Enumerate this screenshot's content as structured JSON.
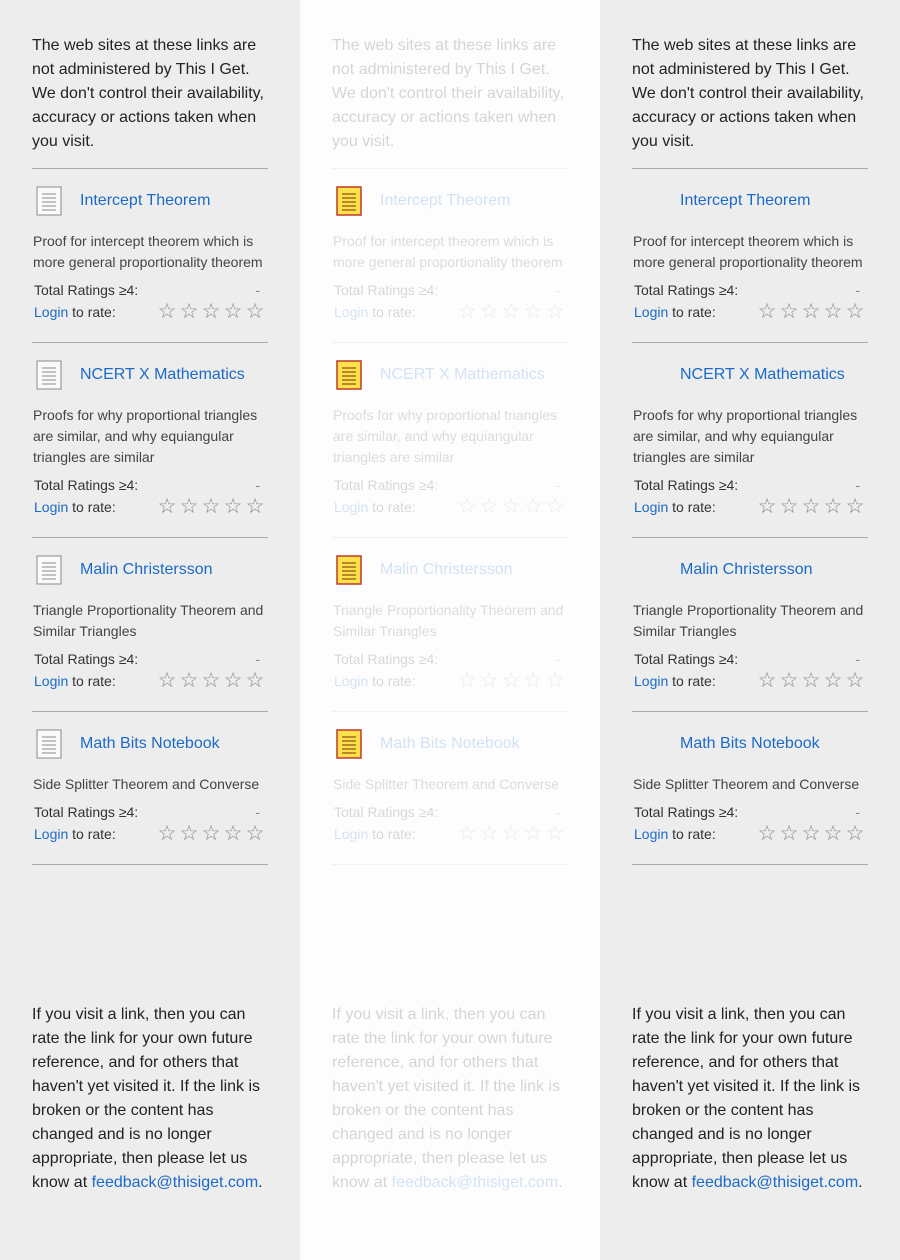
{
  "disclaimer": "The web sites at these links are not administered by This I Get. We don't control their availability, accuracy or actions taken when you visit.",
  "labels": {
    "total_ratings": "Total Ratings ≥4:",
    "ratings_value": "-",
    "login": "Login",
    "to_rate": "to rate:",
    "star_glyph": "☆"
  },
  "links": [
    {
      "title": "Intercept Theorem",
      "description": "Proof for intercept theorem which is more general proportionality theorem"
    },
    {
      "title": "NCERT X Mathematics",
      "description": "Proofs for why proportional triangles are similar, and why equiangular triangles are similar"
    },
    {
      "title": "Malin Christersson",
      "description": "Triangle Proportionality Theorem and Similar Triangles"
    },
    {
      "title": "Math Bits Notebook",
      "description": "Side Splitter Theorem and Converse"
    }
  ],
  "footer": {
    "text": "If you visit a link, then you can rate the link for your own future reference, and for others that haven't yet visited it. If the link is broken or the content has changed and is no longer appropriate, then please let us know at",
    "email": "feedback@thisiget.com",
    "period": "."
  },
  "colors": {
    "link": "#1b6ac9",
    "panel_bg": "#ededed",
    "highlight_panel_bg": "#fdfdfd",
    "icon_gray": "#8a8a8a",
    "icon_highlight_fill": "#ffe24a",
    "icon_highlight_border": "#c0392b"
  },
  "panels": [
    {
      "variant": "plain-icon"
    },
    {
      "variant": "highlighted-icon-dimmed"
    },
    {
      "variant": "no-icon"
    }
  ]
}
